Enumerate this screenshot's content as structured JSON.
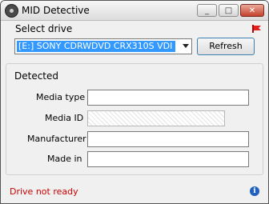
{
  "window": {
    "title": "MID Detective"
  },
  "titlebar_controls": {
    "minimize": "_",
    "maximize": "□",
    "close": "✕"
  },
  "drive_section": {
    "label": "Select drive",
    "selected_drive": "[E:] SONY     CDRWDVD CRX310S  VDI",
    "refresh_label": "Refresh"
  },
  "detected_section": {
    "label": "Detected",
    "fields": [
      {
        "label": "Media type",
        "value": ""
      },
      {
        "label": "Media ID",
        "value": ""
      },
      {
        "label": "Manufacturer",
        "value": ""
      },
      {
        "label": "Made in",
        "value": ""
      }
    ]
  },
  "status": {
    "text": "Drive not ready",
    "color": "#cc0000"
  },
  "info_icon_glyph": "i",
  "icons": [
    "app-icon",
    "flag-icon",
    "chevron-down-icon",
    "info-icon"
  ]
}
